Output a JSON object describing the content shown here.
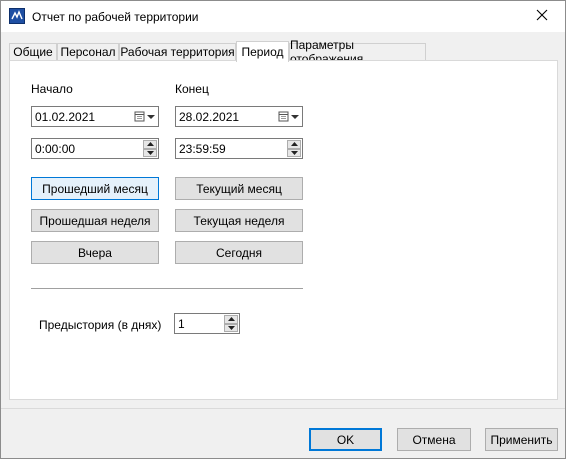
{
  "window": {
    "title": "Отчет по рабочей территории"
  },
  "tabs": [
    {
      "label": "Общие"
    },
    {
      "label": "Персонал"
    },
    {
      "label": "Рабочая территория"
    },
    {
      "label": "Период",
      "active": true
    },
    {
      "label": "Параметры отображения"
    }
  ],
  "period": {
    "start_label": "Начало",
    "end_label": "Конец",
    "start_date": "01.02.2021",
    "end_date": "28.02.2021",
    "start_time": "0:00:00",
    "end_time": "23:59:59",
    "buttons": {
      "last_month": "Прошедший месяц",
      "current_month": "Текущий месяц",
      "last_week": "Прошедшая неделя",
      "current_week": "Текущая неделя",
      "yesterday": "Вчера",
      "today": "Сегодня"
    },
    "prehistory_label": "Предыстория (в днях)",
    "prehistory_value": "1"
  },
  "footer": {
    "ok": "OK",
    "cancel": "Отмена",
    "apply": "Применить"
  },
  "colors": {
    "accent": "#0078d7",
    "hover_fill": "#e5f1fb"
  }
}
